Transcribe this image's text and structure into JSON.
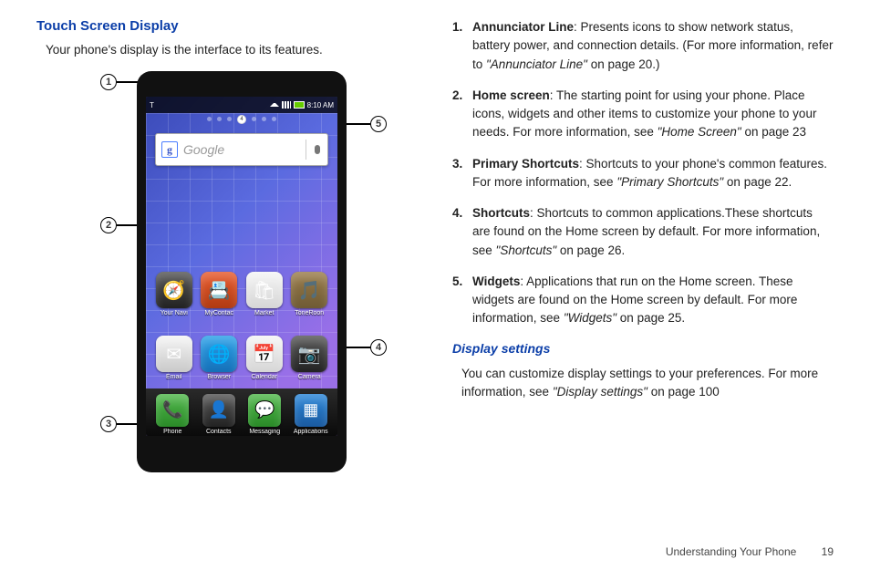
{
  "heading": "Touch Screen Display",
  "intro": "Your phone's display is the interface to its features.",
  "callouts": {
    "c1": "1",
    "c2": "2",
    "c3": "3",
    "c4": "4",
    "c5": "5"
  },
  "phone": {
    "status_time": "8:10 AM",
    "status_left_icon": "T",
    "page_indicator_current": "4",
    "search_placeholder": "Google",
    "row1": [
      {
        "name": "nav",
        "label": "Your Navi",
        "glyph": "🧭"
      },
      {
        "name": "mycontacts",
        "label": "MyContac",
        "glyph": "📇"
      },
      {
        "name": "market",
        "label": "Market",
        "glyph": "🛍"
      },
      {
        "name": "toneroom",
        "label": "ToneRoon",
        "glyph": "🎵"
      }
    ],
    "row2": [
      {
        "name": "email",
        "label": "Email",
        "glyph": "✉"
      },
      {
        "name": "browser",
        "label": "Browser",
        "glyph": "🌐"
      },
      {
        "name": "calendar",
        "label": "Calendar",
        "glyph": "📅"
      },
      {
        "name": "camera",
        "label": "Camera",
        "glyph": "📷"
      }
    ],
    "dock": [
      {
        "name": "phone",
        "label": "Phone",
        "glyph": "📞"
      },
      {
        "name": "contacts",
        "label": "Contacts",
        "glyph": "👤"
      },
      {
        "name": "messaging",
        "label": "Messaging",
        "glyph": "💬"
      },
      {
        "name": "applications",
        "label": "Applications",
        "glyph": "▦"
      }
    ]
  },
  "items": [
    {
      "n": "1.",
      "term": "Annunciator Line",
      "rest_a": ": Presents icons to show network status, battery power, and connection details. (For more information, refer to ",
      "ref": "\"Annunciator Line\"",
      "rest_b": " on page 20.)"
    },
    {
      "n": "2.",
      "term": "Home screen",
      "rest_a": ": The starting point for using your phone. Place icons, widgets and other items to customize your phone to your needs. For more information, see ",
      "ref": "\"Home Screen\"",
      "rest_b": " on page 23"
    },
    {
      "n": "3.",
      "term": "Primary Shortcuts",
      "rest_a": ": Shortcuts to your phone's common features. For more information, see ",
      "ref": "\"Primary Shortcuts\"",
      "rest_b": " on page 22."
    },
    {
      "n": "4.",
      "term": "Shortcuts",
      "rest_a": ": Shortcuts to common applications.These shortcuts are found on the Home screen by default. For more information, see ",
      "ref": "\"Shortcuts\"",
      "rest_b": " on page 26."
    },
    {
      "n": "5.",
      "term": "Widgets",
      "rest_a": ": Applications that run on the Home screen. These widgets are found on the Home screen by default. For more information, see ",
      "ref": "\"Widgets\"",
      "rest_b": " on page 25."
    }
  ],
  "subheading": "Display settings",
  "subtext_a": "You can customize display settings to your preferences. For more information, see ",
  "subtext_ref": "\"Display settings\"",
  "subtext_b": " on page 100",
  "footer_section": "Understanding Your Phone",
  "footer_page": "19"
}
